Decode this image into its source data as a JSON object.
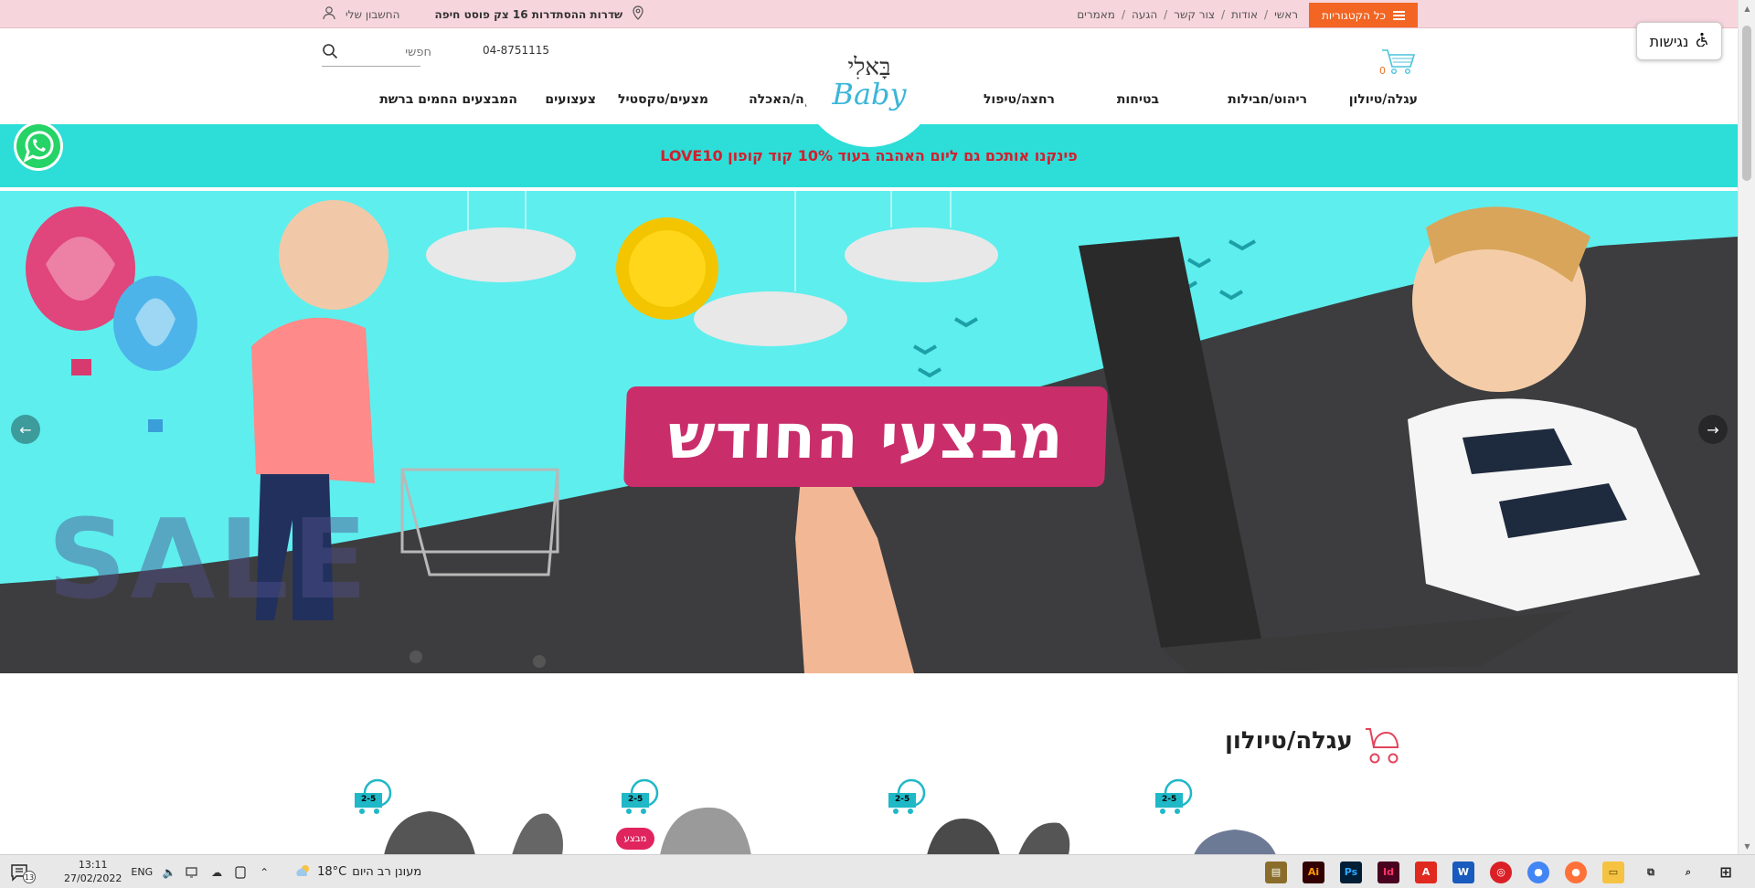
{
  "topbar": {
    "all_categories": "כל הקטגוריות",
    "links": [
      "ראשי",
      "אודות",
      "צור קשר",
      "הגעה",
      "מאמרים"
    ],
    "address": "שדרות ההסתדרות 16 צק פוסט חיפה",
    "account": "החשבון שלי"
  },
  "header": {
    "phone": "04-8751115",
    "search_placeholder": "חפשי",
    "logo_hebrew": "בָּאלִי",
    "logo_english": "Baby",
    "cart_count": "0"
  },
  "nav": {
    "items": [
      "עגלה/טיולון",
      "ריהוט/חבילות",
      "בטיחות",
      "רחצה/טיפול",
      "הנקה/האכלה",
      "מצעים/טקסטיל",
      "צעצועים",
      "המבצעים החמים ברשת"
    ]
  },
  "accessibility": {
    "label": "נגישות"
  },
  "promo": {
    "text": "פינקנו אותכם גם ליום האהבה בעוד 10% קוד קופון LOVE10"
  },
  "hero": {
    "title": "מבצעי החודש",
    "watermark": "SALE"
  },
  "section": {
    "title": "עגלה/טיולון"
  },
  "product_badges": [
    "2-5",
    "2-5",
    "2-5",
    "2-5"
  ],
  "product_tag": "מבצע",
  "taskbar": {
    "time": "13:11",
    "date": "27/02/2022",
    "lang": "ENG",
    "temperature": "18°C",
    "weather": "מעונן רב היום",
    "notifications": "13"
  },
  "colors": {
    "topbar_bg": "#f7d5dc",
    "accent_orange": "#f26522",
    "promo_bg": "#2dddd8",
    "promo_text": "#d0202e",
    "banner_pink": "#c92e6b",
    "logo_blue": "#3bb6d8"
  }
}
